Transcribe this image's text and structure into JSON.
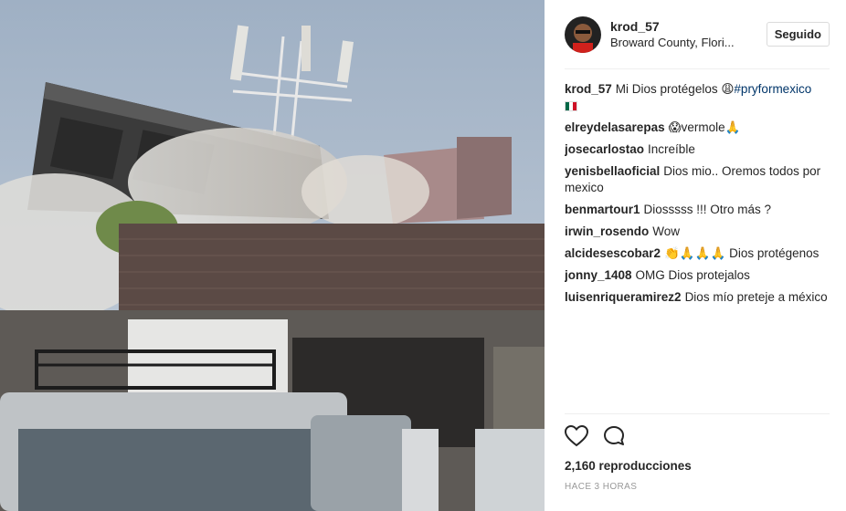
{
  "post": {
    "username": "krod_57",
    "location": "Broward County, Flori...",
    "follow_label": "Seguido",
    "caption_user": "krod_57",
    "caption_text": "Mi Dios protégelos ",
    "caption_emoji": "😩",
    "caption_tag": "#pryformexico",
    "views": "2,160 reproducciones",
    "time": "HACE 3 HORAS"
  },
  "comments": [
    {
      "user": "elreydelasarepas",
      "text": "😱vermole🙏"
    },
    {
      "user": "josecarlostao",
      "text": "Increíble"
    },
    {
      "user": "yenisbellaoficial",
      "text": "Dios mio.. Oremos todos por mexico"
    },
    {
      "user": "benmartour1",
      "text": "Diosssss !!! Otro más ?"
    },
    {
      "user": "irwin_rosendo",
      "text": "Wow"
    },
    {
      "user": "alcidesescobar2",
      "text": "👏🙏🙏🙏 Dios protégenos"
    },
    {
      "user": "jonny_1408",
      "text": "OMG Dios protejalos"
    },
    {
      "user": "luisenriqueramirez2",
      "text": "Dios mío preteje a méxico"
    }
  ],
  "icons": {
    "like": "heart-icon",
    "comment": "comment-icon"
  },
  "colors": {
    "hashtag": "#003569",
    "text": "#262626",
    "muted": "#999999"
  }
}
